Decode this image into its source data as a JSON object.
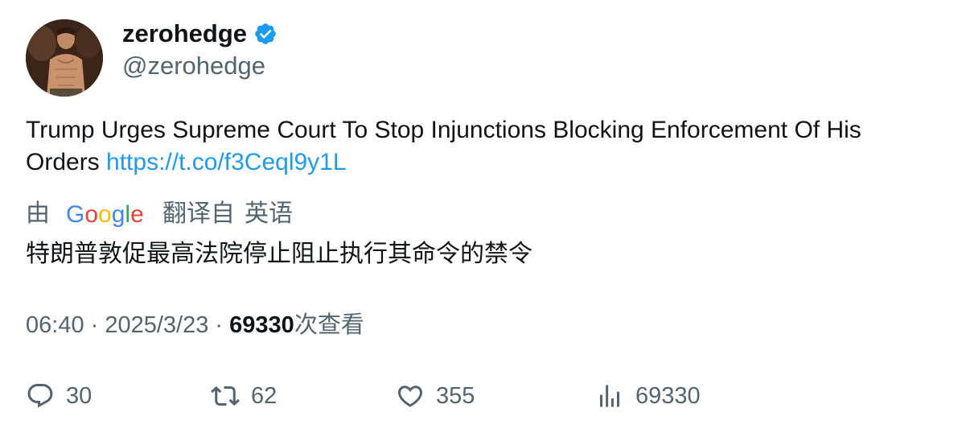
{
  "author": {
    "display_name": "zerohedge",
    "handle": "@zerohedge",
    "verified": true,
    "verified_color": "#1d9bf0"
  },
  "tweet": {
    "text": "Trump Urges Supreme Court To Stop Injunctions Blocking Enforcement Of His Orders ",
    "link": "https://t.co/f3Ceql9y1L"
  },
  "translation": {
    "prefix": "由",
    "provider": "Google",
    "suffix_a": "翻译自",
    "suffix_b": "英语",
    "text": "特朗普敦促最高法院停止阻止执行其命令的禁令"
  },
  "meta": {
    "time": "06:40",
    "separator": " · ",
    "date": "2025/3/23",
    "views_count": "69330",
    "views_label": "次查看"
  },
  "actions": {
    "replies": "30",
    "retweets": "62",
    "likes": "355",
    "views": "69330"
  },
  "colors": {
    "text": "#0f1419",
    "secondary": "#536471",
    "link": "#1d9bf0"
  },
  "icons": [
    "reply-icon",
    "retweet-icon",
    "like-icon",
    "views-icon",
    "verified-badge-icon"
  ]
}
